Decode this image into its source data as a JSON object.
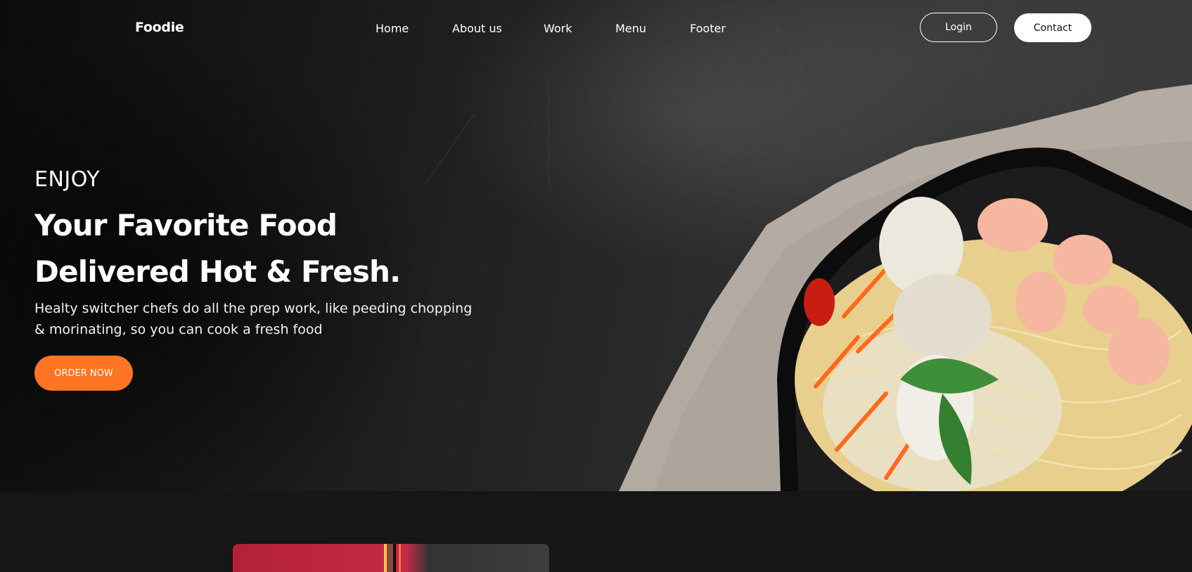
{
  "navbar": {
    "logo": "Foodie",
    "links": [
      "Home",
      "About us",
      "Work",
      "Menu",
      "Footer"
    ],
    "login_label": "Login",
    "contact_label": "Contact"
  },
  "hero": {
    "eyebrow": "ENJOY",
    "headline_line1": "Your Favorite Food",
    "headline_line2": "Delivered Hot & Fresh.",
    "description_line1": "Healty switcher chefs do all the prep work, like peeding chopping",
    "description_line2": "& morinating, so you can cook a fresh food",
    "cta_label": "ORDER NOW"
  },
  "colors": {
    "accent": "#ff7524",
    "background_dark": "#161616"
  }
}
